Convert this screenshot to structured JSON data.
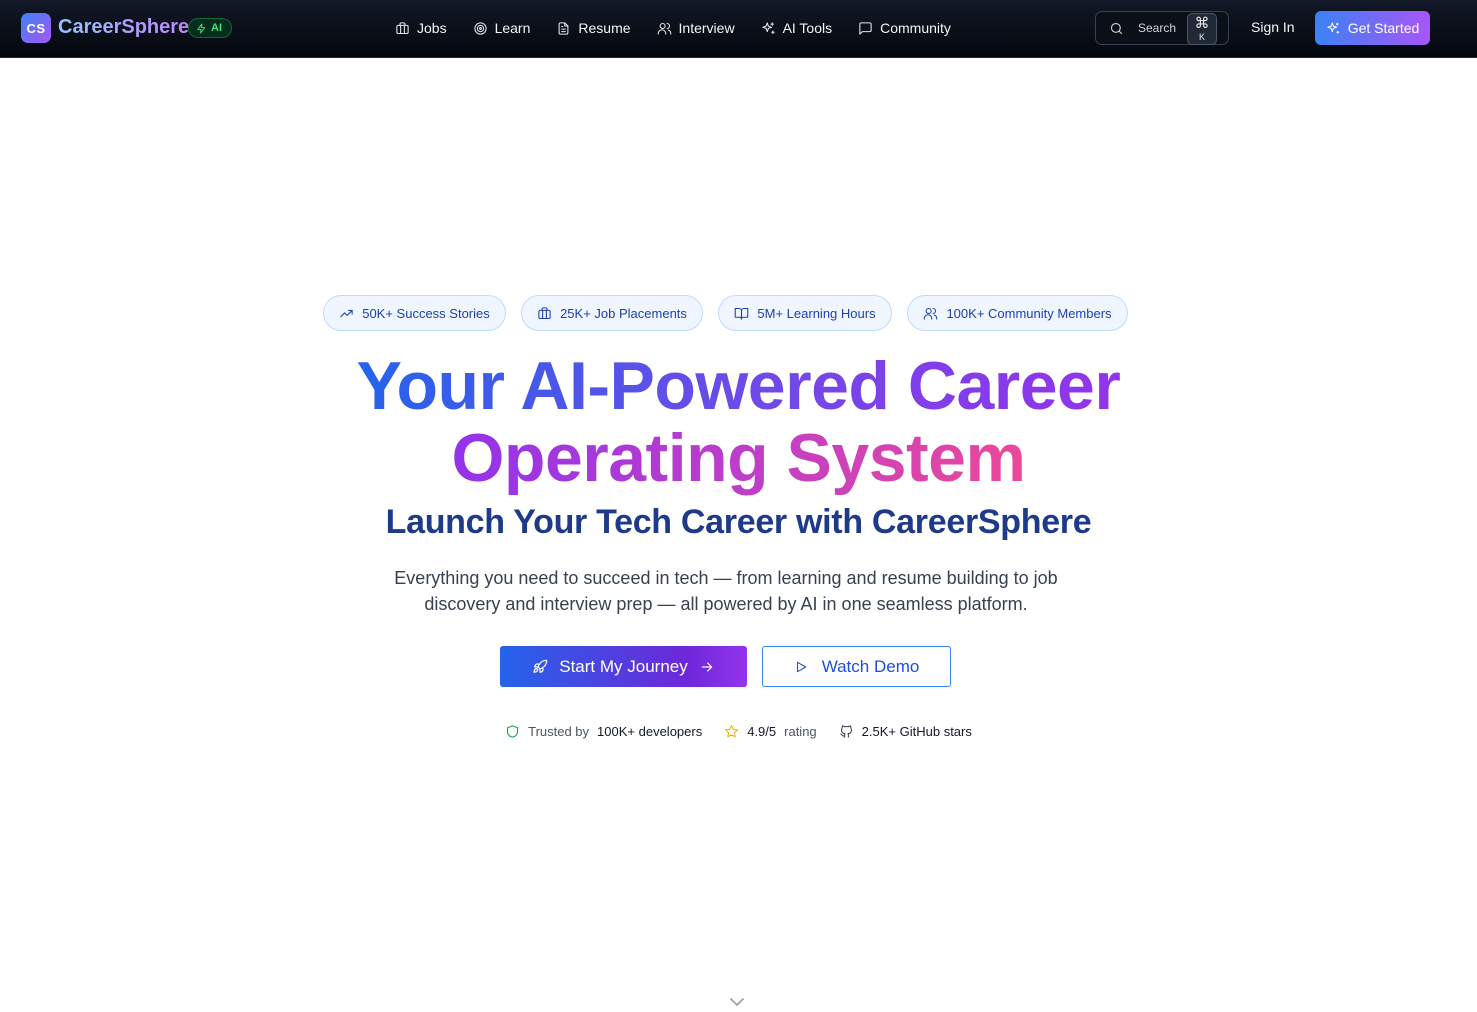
{
  "header": {
    "logo_mark": "CS",
    "brand": "CareerSphere",
    "ai_badge": "AI",
    "nav": [
      {
        "label": "Jobs",
        "icon": "briefcase-icon"
      },
      {
        "label": "Learn",
        "icon": "target-icon"
      },
      {
        "label": "Resume",
        "icon": "file-text-icon"
      },
      {
        "label": "Interview",
        "icon": "users-icon"
      },
      {
        "label": "AI Tools",
        "icon": "sparkles-icon"
      },
      {
        "label": "Community",
        "icon": "message-square-icon"
      }
    ],
    "search": {
      "label": "Search",
      "shortcut_mod": "⌘",
      "shortcut_key": "K"
    },
    "signin_label": "Sign In",
    "get_started_label": "Get Started"
  },
  "stats": [
    {
      "label": "50K+ Success Stories",
      "icon": "trending-up-icon"
    },
    {
      "label": "25K+ Job Placements",
      "icon": "briefcase-icon"
    },
    {
      "label": "5M+ Learning Hours",
      "icon": "book-open-icon"
    },
    {
      "label": "100K+ Community Members",
      "icon": "users-icon"
    }
  ],
  "hero": {
    "title_line1": "Your AI-Powered Career",
    "title_line2": "Operating System",
    "subtitle": "Launch Your Tech Career with CareerSphere",
    "description_line1": "Everything you need to succeed in tech — from learning and resume building to job",
    "description_line2": "discovery and interview prep — all powered by AI in one seamless platform.",
    "primary_cta": "Start My Journey",
    "secondary_cta": "Watch Demo"
  },
  "trust": {
    "trusted_prefix": "Trusted by",
    "trusted_value": "100K+ developers",
    "rating_value": "4.9/5",
    "rating_suffix": "rating",
    "github": "2.5K+ GitHub stars"
  },
  "colors": {
    "brand_blue": "#2563eb",
    "brand_purple": "#9333ea",
    "brand_pink": "#ec4899",
    "navy_text": "#1e3a8a",
    "badge_green": "#4ade80",
    "star_yellow": "#eab308",
    "shield_green": "#16a34a"
  }
}
